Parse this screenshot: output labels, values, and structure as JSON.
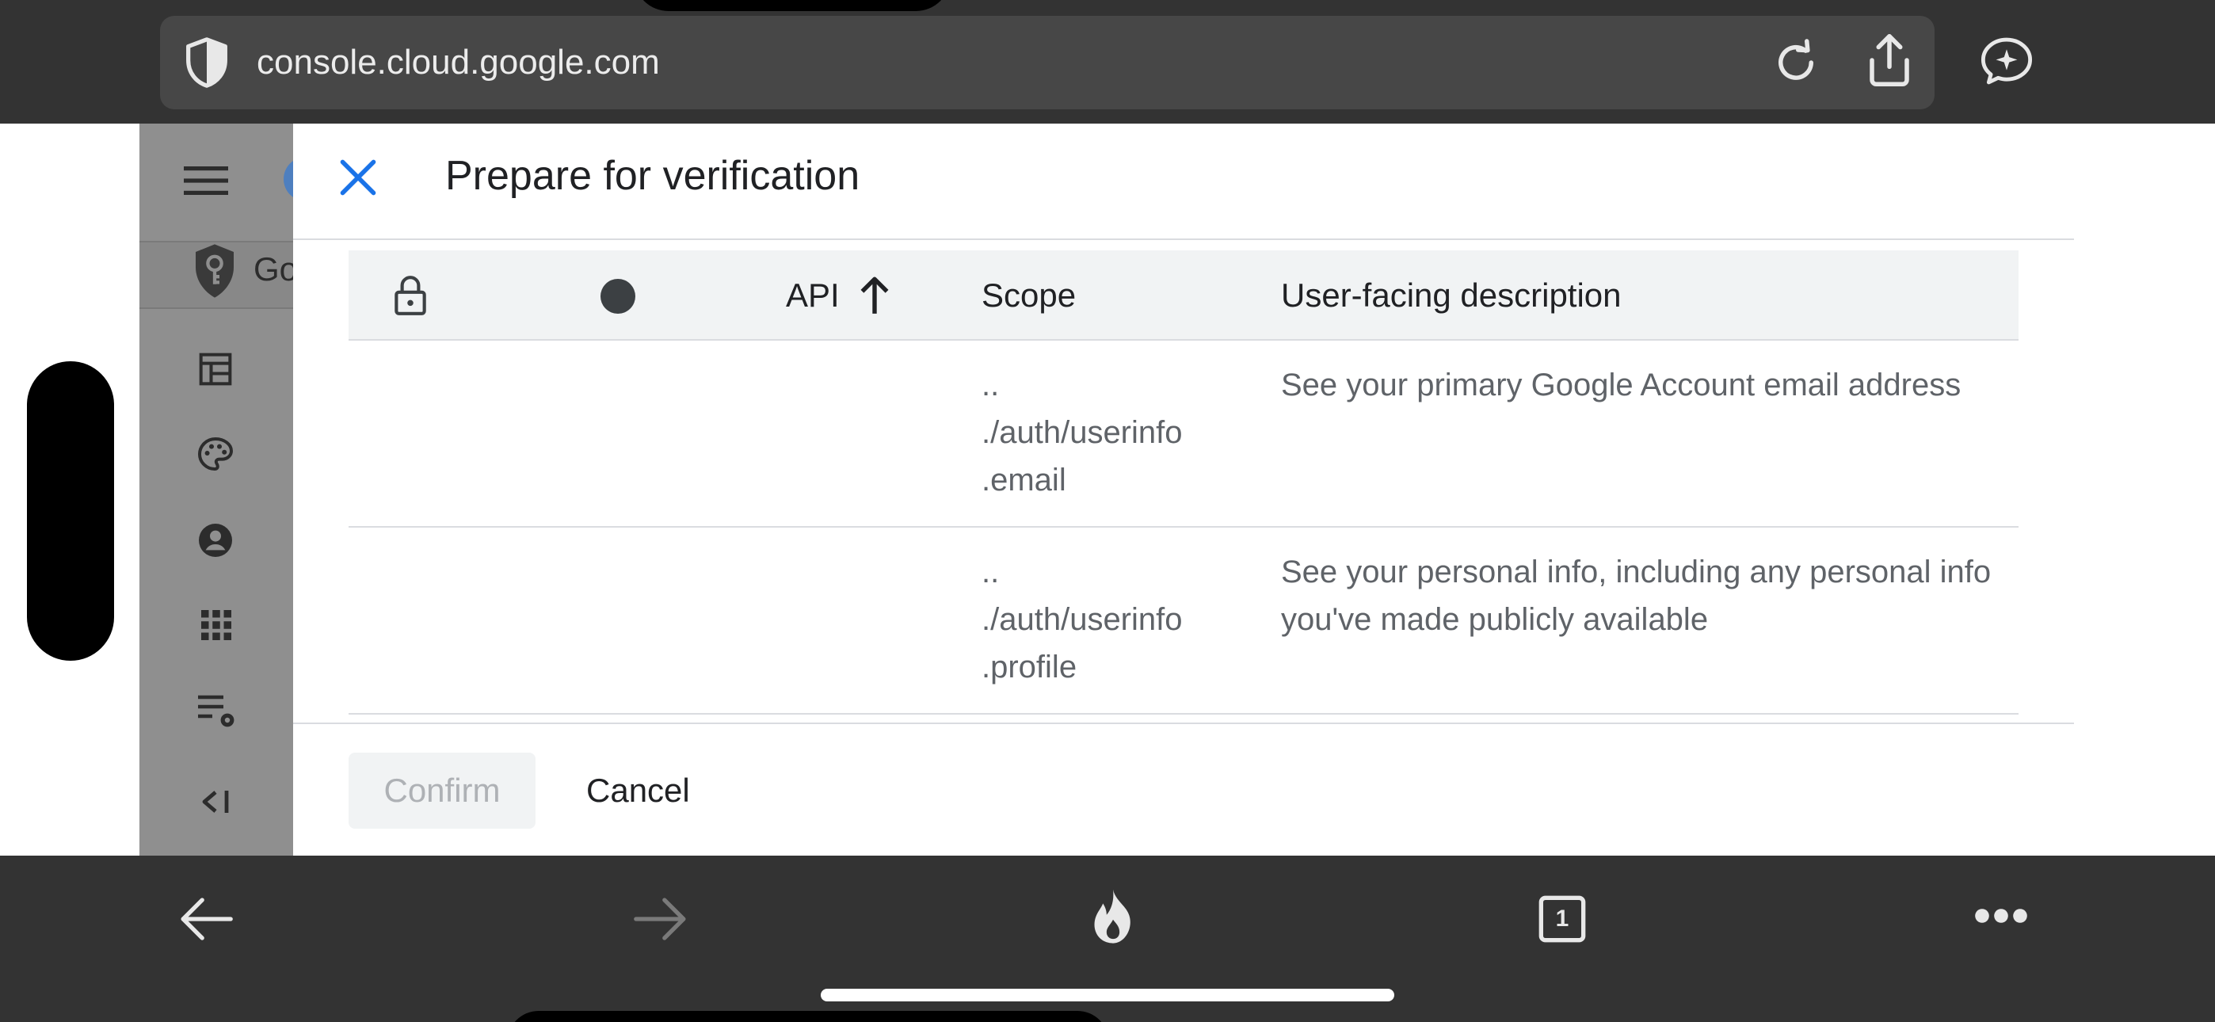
{
  "browser": {
    "url": "console.cloud.google.com",
    "icons": {
      "shield": "shield-icon",
      "reload": "reload-icon",
      "share": "share-icon",
      "assistant": "assistant-chat-icon"
    }
  },
  "console_sidebar": {
    "title_fragment": "Go",
    "icons": [
      "menu-icon",
      "key-shield-icon",
      "dashboard-icon",
      "palette-icon",
      "person-icon",
      "apps-grid-icon",
      "list-settings-icon",
      "collapse-icon"
    ]
  },
  "dialog": {
    "title": "Prepare for verification",
    "table": {
      "headers": {
        "api": "API",
        "scope": "Scope",
        "description": "User-facing description"
      },
      "sort_direction": "ascending",
      "rows": [
        {
          "scope_lines": [
            "..",
            "./auth/userinfo",
            ".email"
          ],
          "description": "See your primary Google Account email address"
        },
        {
          "scope_lines": [
            "..",
            "./auth/userinfo",
            ".profile"
          ],
          "description": "See your personal info, including any personal info you've made publicly available"
        }
      ]
    },
    "buttons": {
      "confirm": "Confirm",
      "cancel": "Cancel"
    }
  },
  "bottom_bar": {
    "tab_count": "1",
    "icons": [
      "back-icon",
      "forward-icon",
      "fire-icon",
      "tabs-icon",
      "more-icon"
    ]
  },
  "colors": {
    "chrome_dark": "#333333",
    "url_bar": "#474747",
    "accent_blue": "#1a73e8",
    "text_primary": "#202124",
    "text_secondary": "#5f6368",
    "header_bg": "#f1f3f4",
    "divider": "#dadce0"
  }
}
